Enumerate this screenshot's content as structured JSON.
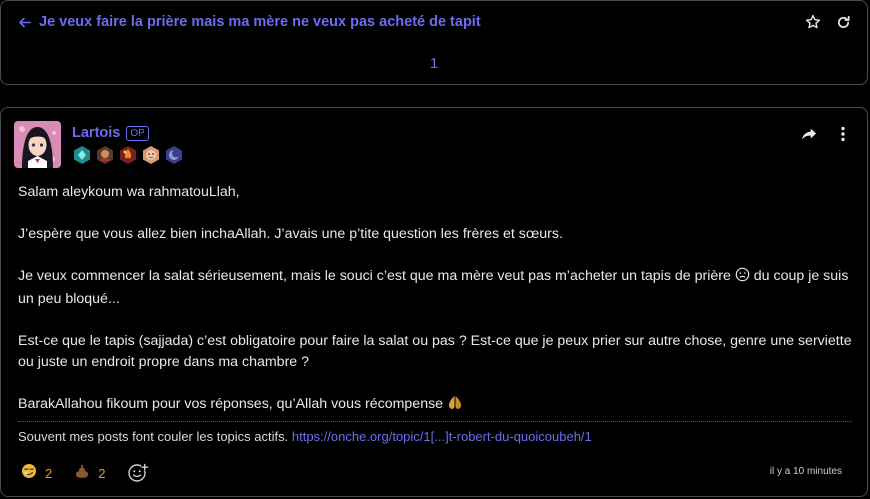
{
  "topic": {
    "title": "Je veux faire la prière mais ma mère ne veux pas acheté de tapit",
    "back_icon": "arrow-left-icon",
    "favorite_icon": "star-icon",
    "refresh_icon": "refresh-icon",
    "page_current": "1"
  },
  "post": {
    "author": "Lartois",
    "op_label": "OP",
    "badges": [
      "diamond-badge",
      "character-badge",
      "fire-badge",
      "face-badge",
      "moon-badge"
    ],
    "share_icon": "share-icon",
    "menu_icon": "more-vertical-icon",
    "body": {
      "p1": "Salam aleykoum wa rahmatouLlah,",
      "p2": "J’espère que vous allez bien inchaAllah. J’avais une p’tite question les frères et sœurs.",
      "p3": "Je veux commencer la salat sérieusement, mais le souci c’est que ma mère veut pas m’acheter un tapis de prière",
      "p3b": "du coup je suis un peu bloqué...",
      "p4": "Est-ce que le tapis (sajjada) c’est obligatoire pour faire la salat ou pas ? Est-ce que je peux prier sur autre chose, genre une serviette ou juste un endroit propre dans ma chambre ?",
      "p5": "BarakAllahou fikoum pour vos réponses, qu’Allah vous récompense"
    },
    "signature": {
      "text": "Souvent mes posts font couler les topics actifs.",
      "link": "https://onche.org/topic/1[...]t-robert-du-quoicoubeh/1"
    },
    "reactions": [
      {
        "icon": "smirk-emoji-icon",
        "count": "2"
      },
      {
        "icon": "poop-emoji-icon",
        "count": "2"
      }
    ],
    "add_reaction_icon": "add-reaction-icon",
    "timestamp": "il y a 10 minutes"
  },
  "colors": {
    "accent": "#6b6cf0",
    "background": "#000000",
    "border": "#4a4a52",
    "reaction_count": "#d8a33a"
  }
}
